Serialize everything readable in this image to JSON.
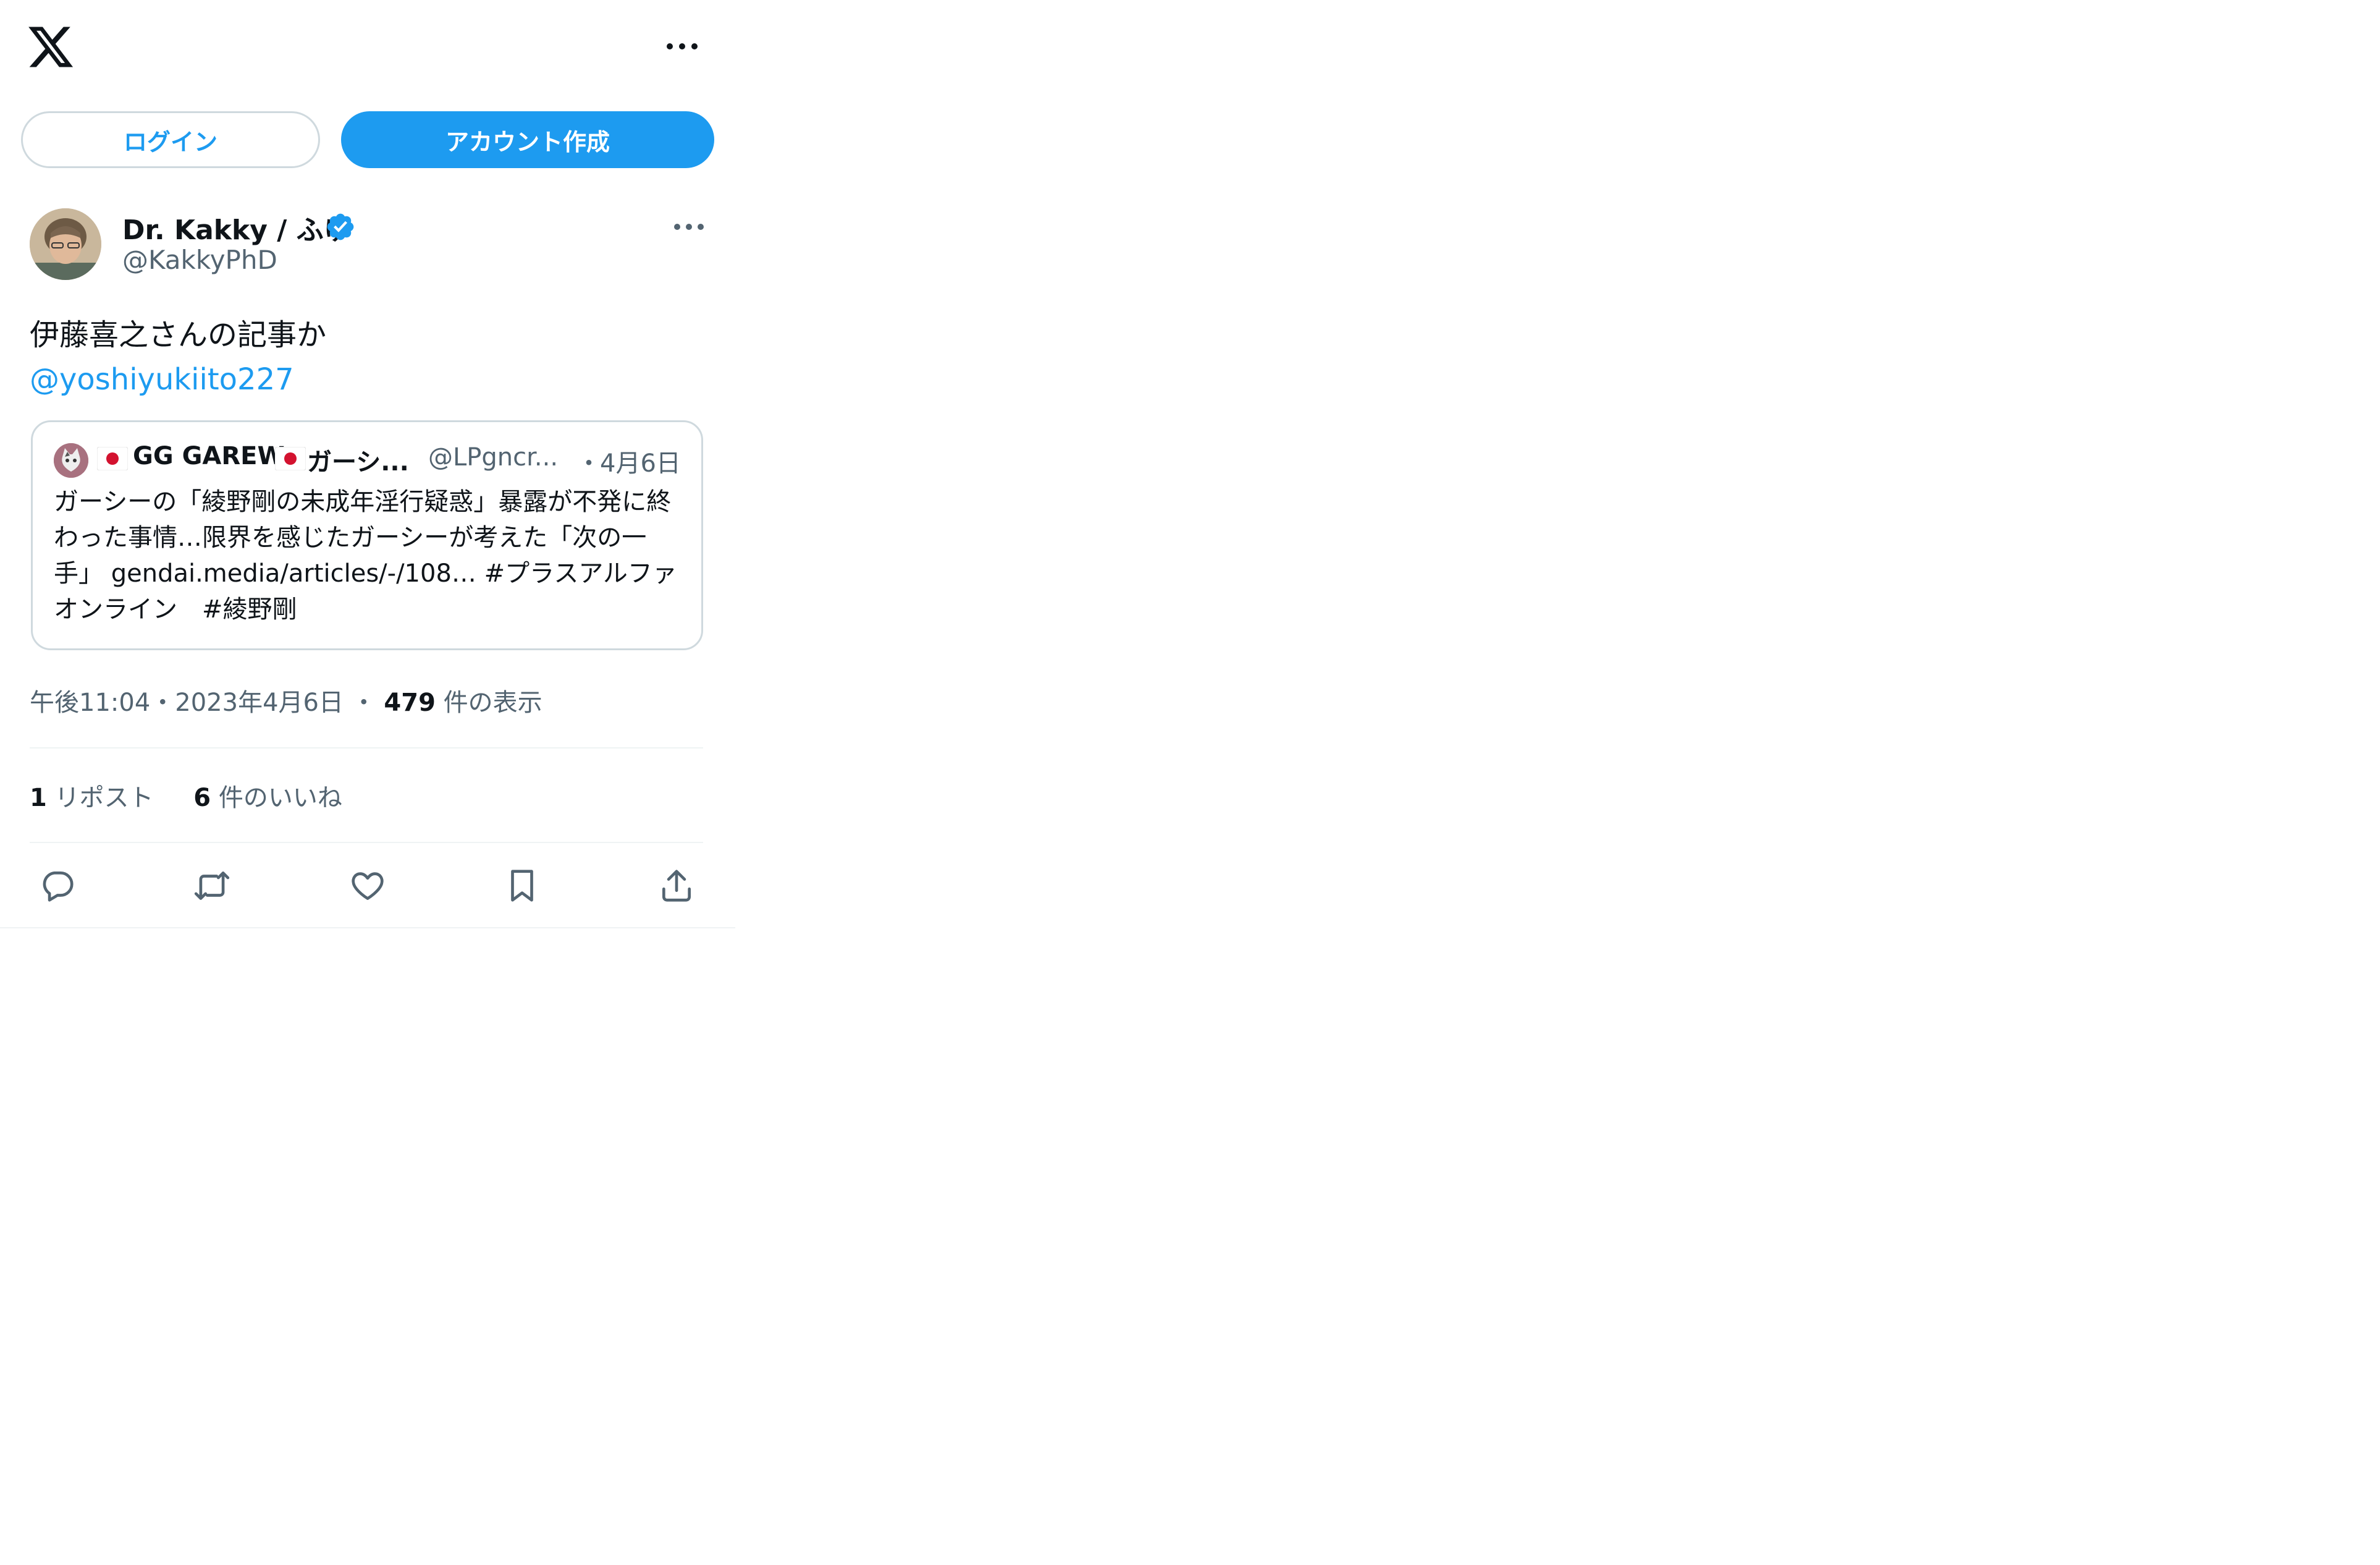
{
  "header": {
    "logo": "x-logo-icon",
    "more": "more-icon"
  },
  "auth": {
    "login_label": "ログイン",
    "signup_label": "アカウント作成"
  },
  "post": {
    "author_name": "Dr. Kakky / ふゆ",
    "author_handle": "@KakkyPhD",
    "text": "伊藤喜之さんの記事か",
    "mention": "@yoshiyukiito227",
    "timestamp": "午後11:04・2023年4月6日",
    "separator": "・",
    "views_count": "479",
    "views_label": "件の表示",
    "reposts_count": "1",
    "reposts_label": "リポスト",
    "likes_count": "6",
    "likes_label": "件のいいね"
  },
  "quote": {
    "name_part1": "GG GAREW",
    "name_part2": "ガーシ...",
    "handle": "@LPgncr...",
    "dot": "・",
    "date": "4月6日",
    "text": "ガーシーの「綾野剛の未成年淫行疑惑」暴露が不発に終わった事情…限界を感じたガーシーが考えた「次の一手」 gendai.media/articles/-/108… #プラスアルファオンライン　#綾野剛"
  },
  "colors": {
    "accent": "#1d9bf0",
    "text": "#0f1419",
    "secondary": "#536471",
    "border": "#cfd9de"
  }
}
